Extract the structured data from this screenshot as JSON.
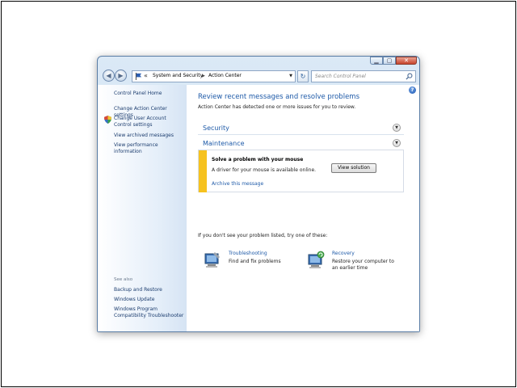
{
  "window": {
    "caption_buttons": [
      "minimize",
      "maximize",
      "close"
    ]
  },
  "navbar": {
    "breadcrumb": [
      "System and Security",
      "Action Center"
    ],
    "search_placeholder": "Search Control Panel"
  },
  "sidebar": {
    "items": [
      {
        "label": "Control Panel Home"
      },
      {
        "label": "Change Action Center settings"
      },
      {
        "label": "Change User Account Control settings"
      },
      {
        "label": "View archived messages"
      },
      {
        "label": "View performance information"
      }
    ],
    "see_also_label": "See also",
    "see_also": [
      {
        "label": "Backup and Restore"
      },
      {
        "label": "Windows Update"
      },
      {
        "label": "Windows Program Compatibility Troubleshooter"
      }
    ]
  },
  "main": {
    "title": "Review recent messages and resolve problems",
    "subtitle": "Action Center has detected one or more issues for you to review.",
    "sections": [
      {
        "label": "Security"
      },
      {
        "label": "Maintenance"
      }
    ],
    "alert": {
      "title": "Solve a problem with your mouse",
      "description": "A driver for your mouse is available online.",
      "button": "View solution",
      "archive_link": "Archive this message",
      "accent_color": "#f6c21f"
    },
    "try_text": "If you don't see your problem listed, try one of these:",
    "tools": [
      {
        "name": "Troubleshooting",
        "description": "Find and fix problems",
        "icon": "troubleshooting-icon"
      },
      {
        "name": "Recovery",
        "description": "Restore your computer to an earlier time",
        "icon": "recovery-icon"
      }
    ]
  }
}
